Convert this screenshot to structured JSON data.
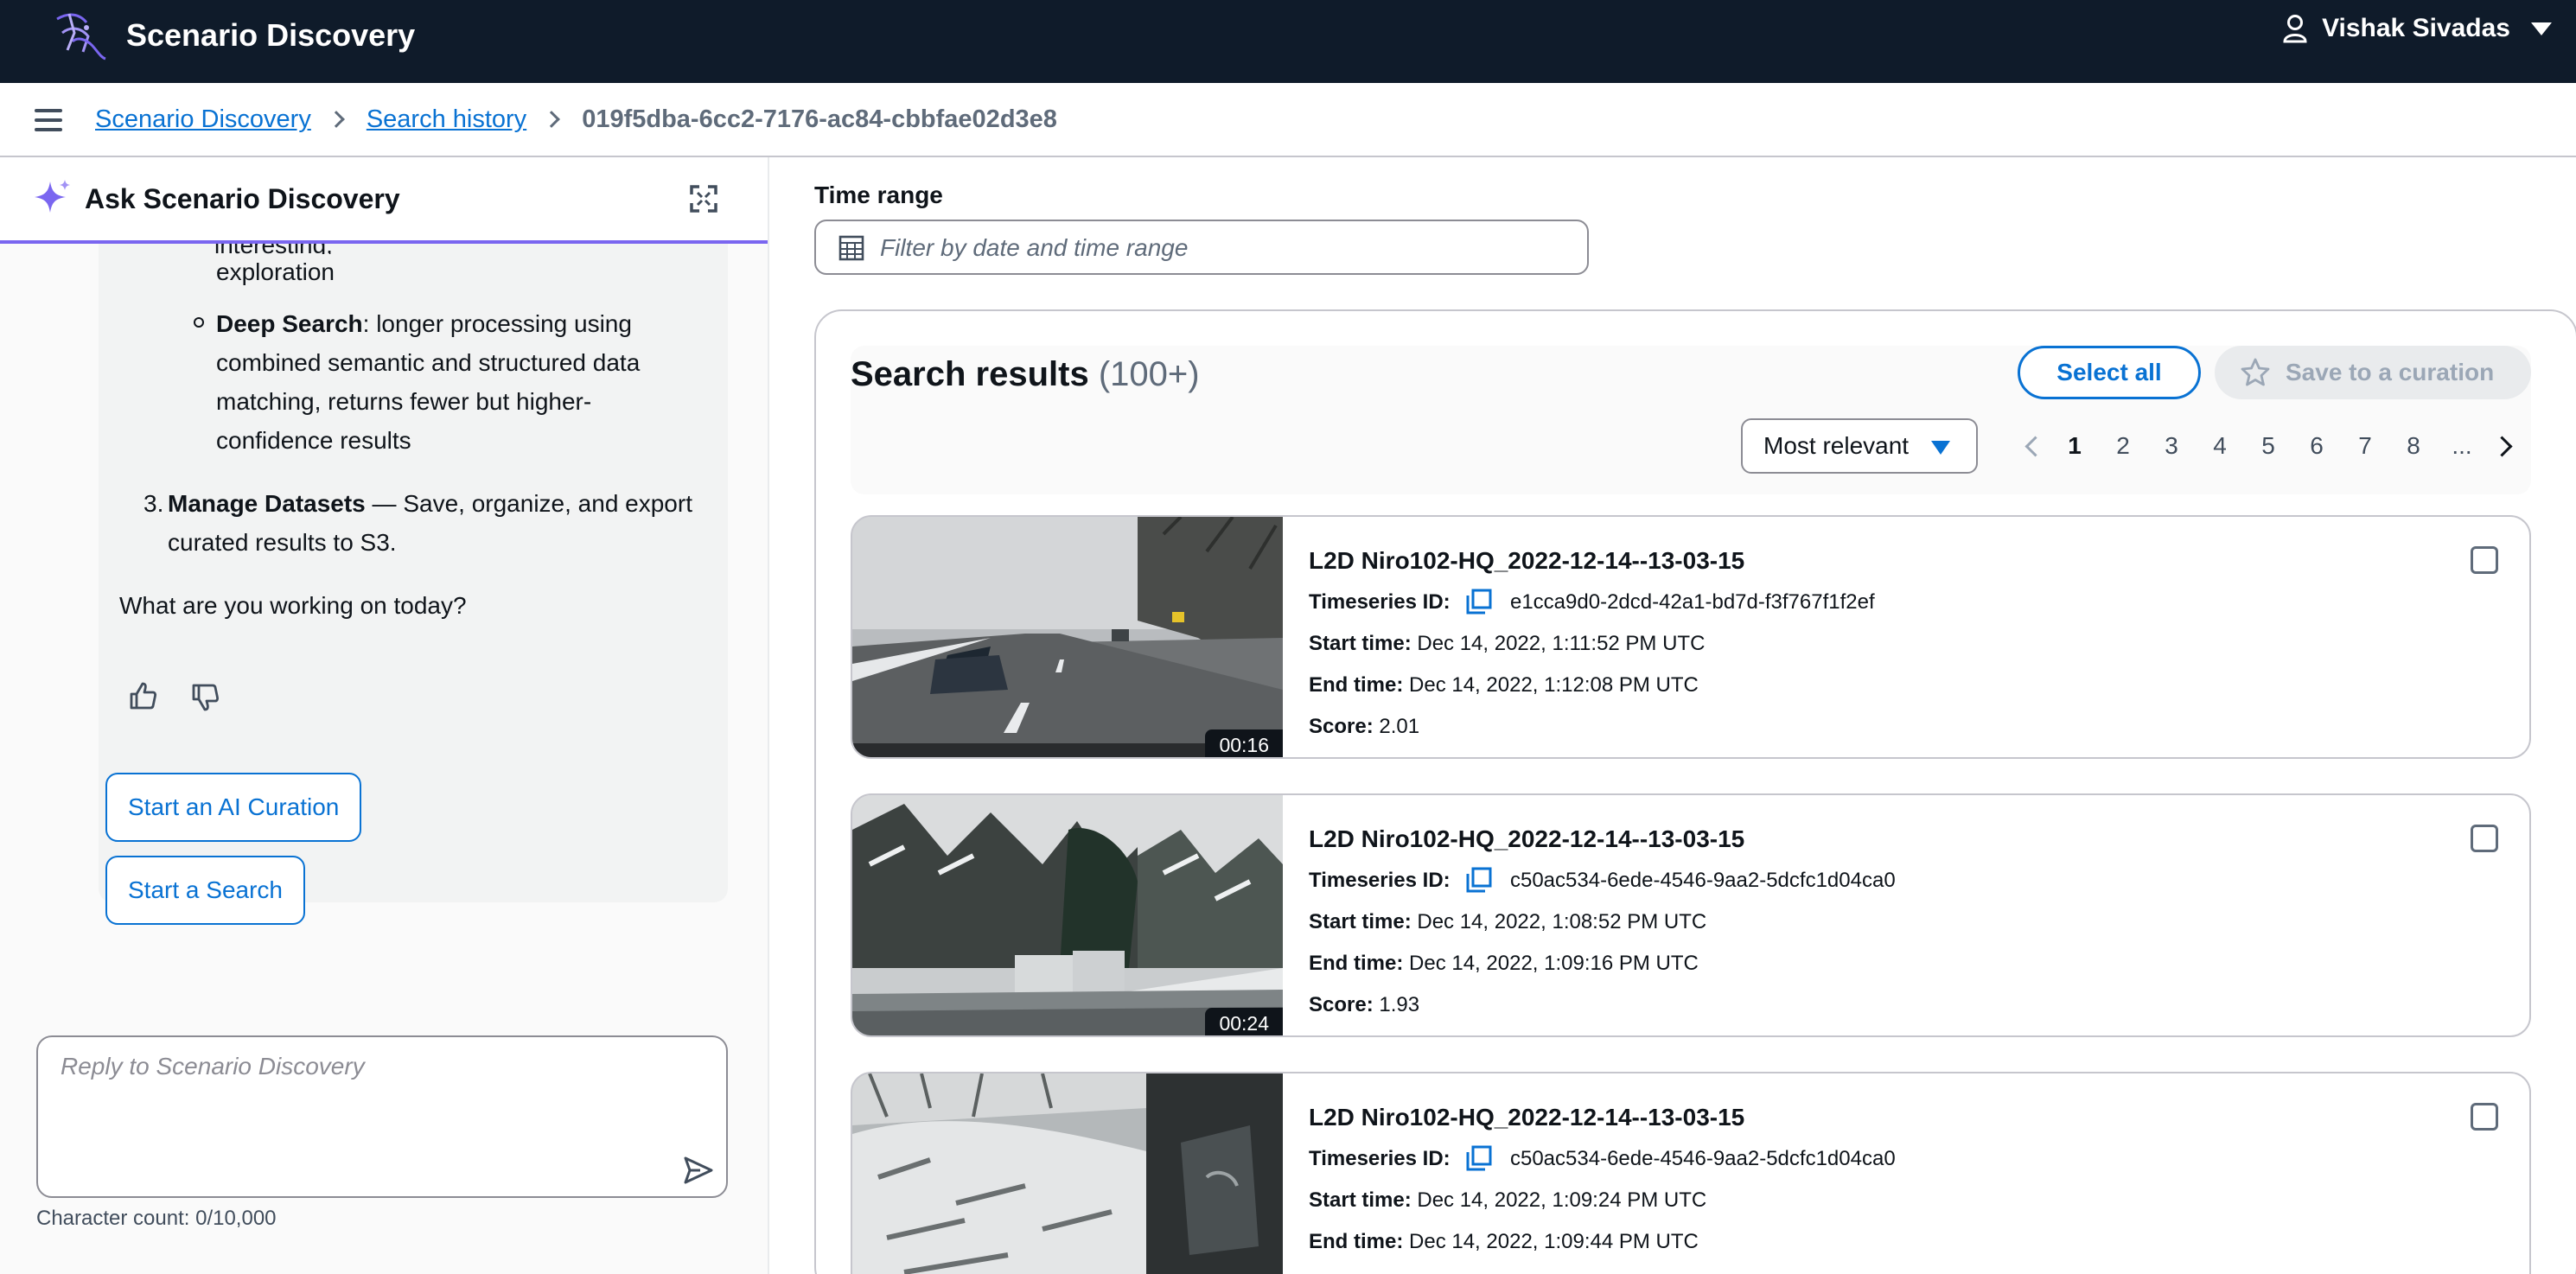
{
  "app": {
    "title": "Scenario Discovery"
  },
  "user": {
    "name": "Vishak Sivadas"
  },
  "breadcrumb": {
    "items": [
      "Scenario Discovery",
      "Search history"
    ],
    "current": "019f5dba-6cc2-7176-ac84-cbbfae02d3e8"
  },
  "assistant": {
    "title": "Ask Scenario Discovery",
    "messages": {
      "cut_line": "interesting,",
      "exploration": "exploration",
      "deep_search_label": "Deep Search",
      "deep_search_lines": [
        ": longer processing using",
        "combined semantic and structured data",
        "matching, returns fewer but higher-",
        "confidence results"
      ],
      "item3_number": "3.",
      "item3_label": "Manage Datasets",
      "item3_lines": [
        " — Save, organize, and export",
        "curated results to S3."
      ],
      "question": "What are you working on today?"
    },
    "actions": {
      "start_curation": "Start an AI Curation",
      "start_search": "Start a Search"
    },
    "reply_placeholder": "Reply to Scenario Discovery",
    "char_count": "Character count: 0/10,000"
  },
  "filters": {
    "time_label": "Time range",
    "time_placeholder": "Filter by date and time range"
  },
  "results": {
    "title": "Search results",
    "count": "(100+)",
    "select_all": "Select all",
    "save_curation": "Save to a curation",
    "sort": "Most relevant",
    "pages": [
      "1",
      "2",
      "3",
      "4",
      "5",
      "6",
      "7",
      "8",
      "..."
    ],
    "current_page": "1",
    "labels": {
      "timeseries": "Timeseries ID:",
      "start": "Start time:",
      "end": "End time:",
      "score": "Score:"
    },
    "items": [
      {
        "title": "L2D Niro102-HQ_2022-12-14--13-03-15",
        "timeseries_id": "e1cca9d0-2dcd-42a1-bd7d-f3f767f1f2ef",
        "start_time": "Dec 14, 2022, 1:11:52 PM UTC",
        "end_time": "Dec 14, 2022, 1:12:08 PM UTC",
        "score": "2.01",
        "duration": "00:16"
      },
      {
        "title": "L2D Niro102-HQ_2022-12-14--13-03-15",
        "timeseries_id": "c50ac534-6ede-4546-9aa2-5dcfc1d04ca0",
        "start_time": "Dec 14, 2022, 1:08:52 PM UTC",
        "end_time": "Dec 14, 2022, 1:09:16 PM UTC",
        "score": "1.93",
        "duration": "00:24"
      },
      {
        "title": "L2D Niro102-HQ_2022-12-14--13-03-15",
        "timeseries_id": "c50ac534-6ede-4546-9aa2-5dcfc1d04ca0",
        "start_time": "Dec 14, 2022, 1:09:24 PM UTC",
        "end_time": "Dec 14, 2022, 1:09:44 PM UTC"
      }
    ]
  },
  "colors": {
    "topbar": "#0f1b2a",
    "link": "#0972d3",
    "accent": "#7a66f0"
  },
  "icons": [
    "aws-logo-icon",
    "user-icon",
    "caret-down-icon",
    "menu-icon",
    "chevron-right-icon",
    "sparkle-icon",
    "expand-icon",
    "thumbs-up-icon",
    "thumbs-down-icon",
    "send-icon",
    "calendar-icon",
    "star-icon",
    "copy-icon",
    "checkbox-icon"
  ]
}
